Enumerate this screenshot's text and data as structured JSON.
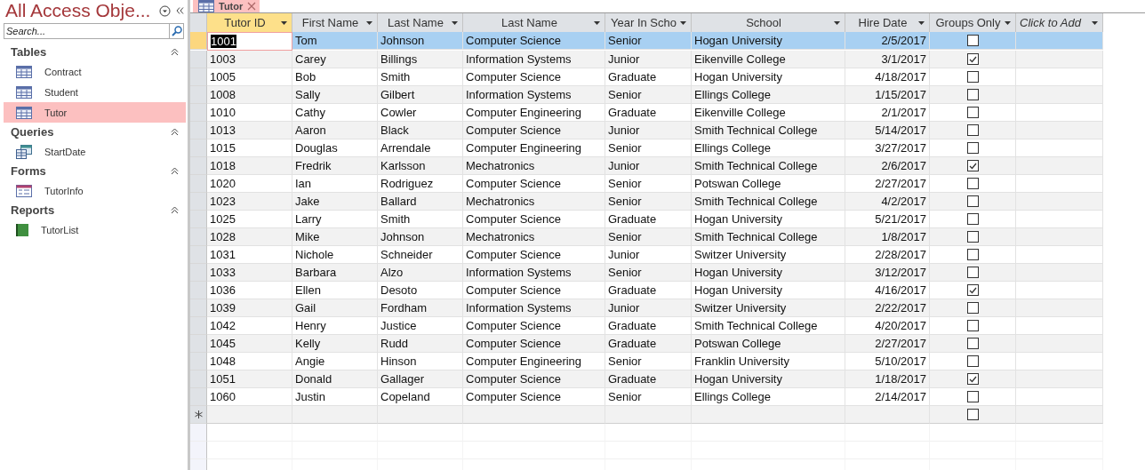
{
  "navigation_pane": {
    "title": "All Access Obje...",
    "search": {
      "placeholder": "Search..."
    },
    "groups": [
      {
        "label": "Tables",
        "items": [
          {
            "label": "Contract",
            "kind": "table",
            "selected": false
          },
          {
            "label": "Student",
            "kind": "table",
            "selected": false
          },
          {
            "label": "Tutor",
            "kind": "table",
            "selected": true
          }
        ]
      },
      {
        "label": "Queries",
        "items": [
          {
            "label": "StartDate",
            "kind": "query",
            "selected": false
          }
        ]
      },
      {
        "label": "Forms",
        "items": [
          {
            "label": "TutorInfo",
            "kind": "form",
            "selected": false
          }
        ]
      },
      {
        "label": "Reports",
        "items": [
          {
            "label": "TutorList",
            "kind": "report",
            "selected": false
          }
        ]
      }
    ]
  },
  "tab": {
    "label": "Tutor"
  },
  "table": {
    "columns": [
      {
        "label": "Tutor ID",
        "kind": "text",
        "selected": true
      },
      {
        "label": "First Name",
        "kind": "text",
        "selected": false
      },
      {
        "label": "Last Name",
        "kind": "text",
        "selected": false
      },
      {
        "label": "Last Name",
        "kind": "text",
        "selected": false
      },
      {
        "label": "Year In Scho",
        "kind": "text",
        "selected": false
      },
      {
        "label": "School",
        "kind": "text",
        "selected": false
      },
      {
        "label": "Hire Date",
        "kind": "date",
        "selected": false
      },
      {
        "label": "Groups Only",
        "kind": "check",
        "selected": false
      },
      {
        "label": "Click to Add",
        "kind": "add",
        "selected": false
      }
    ],
    "rows": [
      {
        "cells": [
          "1001",
          "Tom",
          "Johnson",
          "Computer Science",
          "Senior",
          "Hogan University",
          "2/5/2017"
        ],
        "groups_only": false,
        "selected": true
      },
      {
        "cells": [
          "1003",
          "Carey",
          "Billings",
          "Information Systems",
          "Junior",
          "Eikenville College",
          "3/1/2017"
        ],
        "groups_only": true,
        "selected": false
      },
      {
        "cells": [
          "1005",
          "Bob",
          "Smith",
          "Computer Science",
          "Graduate",
          "Hogan University",
          "4/18/2017"
        ],
        "groups_only": false,
        "selected": false
      },
      {
        "cells": [
          "1008",
          "Sally",
          "Gilbert",
          "Information Systems",
          "Senior",
          "Ellings College",
          "1/15/2017"
        ],
        "groups_only": false,
        "selected": false
      },
      {
        "cells": [
          "1010",
          "Cathy",
          "Cowler",
          "Computer Engineering",
          "Graduate",
          "Eikenville College",
          "2/1/2017"
        ],
        "groups_only": false,
        "selected": false
      },
      {
        "cells": [
          "1013",
          "Aaron",
          "Black",
          "Computer Science",
          "Junior",
          "Smith Technical College",
          "5/14/2017"
        ],
        "groups_only": false,
        "selected": false
      },
      {
        "cells": [
          "1015",
          "Douglas",
          "Arrendale",
          "Computer Engineering",
          "Senior",
          "Ellings College",
          "3/27/2017"
        ],
        "groups_only": false,
        "selected": false
      },
      {
        "cells": [
          "1018",
          "Fredrik",
          "Karlsson",
          "Mechatronics",
          "Junior",
          "Smith Technical College",
          "2/6/2017"
        ],
        "groups_only": true,
        "selected": false
      },
      {
        "cells": [
          "1020",
          "Ian",
          "Rodriguez",
          "Computer Science",
          "Senior",
          "Potswan College",
          "2/27/2017"
        ],
        "groups_only": false,
        "selected": false
      },
      {
        "cells": [
          "1023",
          "Jake",
          "Ballard",
          "Mechatronics",
          "Senior",
          "Smith Technical College",
          "4/2/2017"
        ],
        "groups_only": false,
        "selected": false
      },
      {
        "cells": [
          "1025",
          "Larry",
          "Smith",
          "Computer Science",
          "Graduate",
          "Hogan University",
          "5/21/2017"
        ],
        "groups_only": false,
        "selected": false
      },
      {
        "cells": [
          "1028",
          "Mike",
          "Johnson",
          "Mechatronics",
          "Senior",
          "Smith Technical College",
          "1/8/2017"
        ],
        "groups_only": false,
        "selected": false
      },
      {
        "cells": [
          "1031",
          "Nichole",
          "Schneider",
          "Computer Science",
          "Junior",
          "Switzer University",
          "2/28/2017"
        ],
        "groups_only": false,
        "selected": false
      },
      {
        "cells": [
          "1033",
          "Barbara",
          "Alzo",
          "Information Systems",
          "Senior",
          "Hogan University",
          "3/12/2017"
        ],
        "groups_only": false,
        "selected": false
      },
      {
        "cells": [
          "1036",
          "Ellen",
          "Desoto",
          "Computer Science",
          "Graduate",
          "Hogan University",
          "4/16/2017"
        ],
        "groups_only": true,
        "selected": false
      },
      {
        "cells": [
          "1039",
          "Gail",
          "Fordham",
          "Information Systems",
          "Junior",
          "Switzer University",
          "2/22/2017"
        ],
        "groups_only": false,
        "selected": false
      },
      {
        "cells": [
          "1042",
          "Henry",
          "Justice",
          "Computer Science",
          "Graduate",
          "Smith Technical College",
          "4/20/2017"
        ],
        "groups_only": false,
        "selected": false
      },
      {
        "cells": [
          "1045",
          "Kelly",
          "Rudd",
          "Computer Science",
          "Graduate",
          "Potswan College",
          "2/27/2017"
        ],
        "groups_only": false,
        "selected": false
      },
      {
        "cells": [
          "1048",
          "Angie",
          "Hinson",
          "Computer Engineering",
          "Senior",
          "Franklin University",
          "5/10/2017"
        ],
        "groups_only": false,
        "selected": false
      },
      {
        "cells": [
          "1051",
          "Donald",
          "Gallager",
          "Computer Science",
          "Graduate",
          "Hogan University",
          "1/18/2017"
        ],
        "groups_only": true,
        "selected": false
      },
      {
        "cells": [
          "1060",
          "Justin",
          "Copeland",
          "Computer Science",
          "Senior",
          "Ellings College",
          "2/14/2017"
        ],
        "groups_only": false,
        "selected": false
      }
    ],
    "new_row": {
      "groups_only": false
    }
  }
}
